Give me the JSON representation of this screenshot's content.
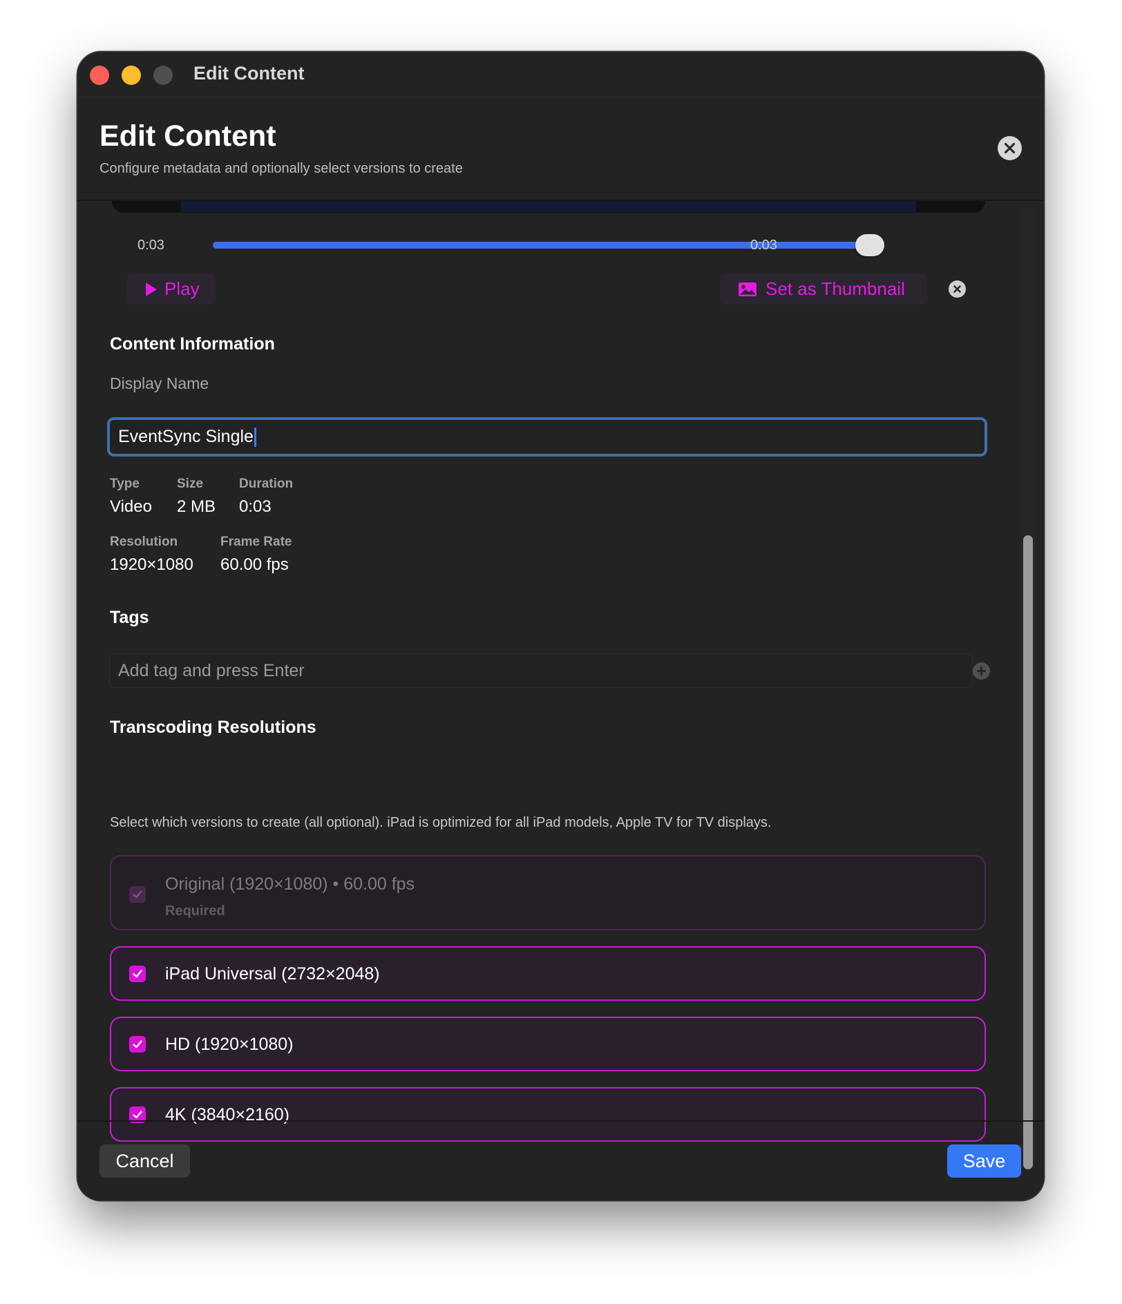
{
  "window": {
    "title": "Edit Content"
  },
  "header": {
    "title": "Edit Content",
    "subtitle": "Configure metadata and optionally select versions to create"
  },
  "media": {
    "time_start": "0:03",
    "time_end": "0:03",
    "scrub_position": 1.0,
    "play_label": "Play",
    "thumbnail_label": "Set as Thumbnail"
  },
  "content_info": {
    "section_title": "Content Information",
    "display_name_label": "Display Name",
    "display_name_value": "EventSync Single",
    "type_label": "Type",
    "type_value": "Video",
    "size_label": "Size",
    "size_value": "2 MB",
    "duration_label": "Duration",
    "duration_value": "0:03",
    "resolution_label": "Resolution",
    "resolution_value": "1920×1080",
    "frame_rate_label": "Frame Rate",
    "frame_rate_value": "60.00 fps"
  },
  "tags": {
    "section_title": "Tags",
    "placeholder": "Add tag and press Enter"
  },
  "transcoding": {
    "section_title": "Transcoding Resolutions",
    "helper": "Select which versions to create (all optional). iPad is optimized for all iPad models, Apple TV for TV displays.",
    "options": [
      {
        "label": "Original (1920×1080) • 60.00 fps",
        "sub": "Required",
        "checked": true,
        "disabled": true
      },
      {
        "label": "iPad Universal (2732×2048)",
        "checked": true,
        "disabled": false
      },
      {
        "label": "HD (1920×1080)",
        "checked": true,
        "disabled": false
      },
      {
        "label": "4K (3840×2160)",
        "checked": true,
        "disabled": false
      }
    ]
  },
  "footer": {
    "cancel_label": "Cancel",
    "save_label": "Save"
  },
  "colors": {
    "accent_magenta": "#e21ce2",
    "accent_blue": "#3478f6",
    "window_bg": "#232323"
  }
}
